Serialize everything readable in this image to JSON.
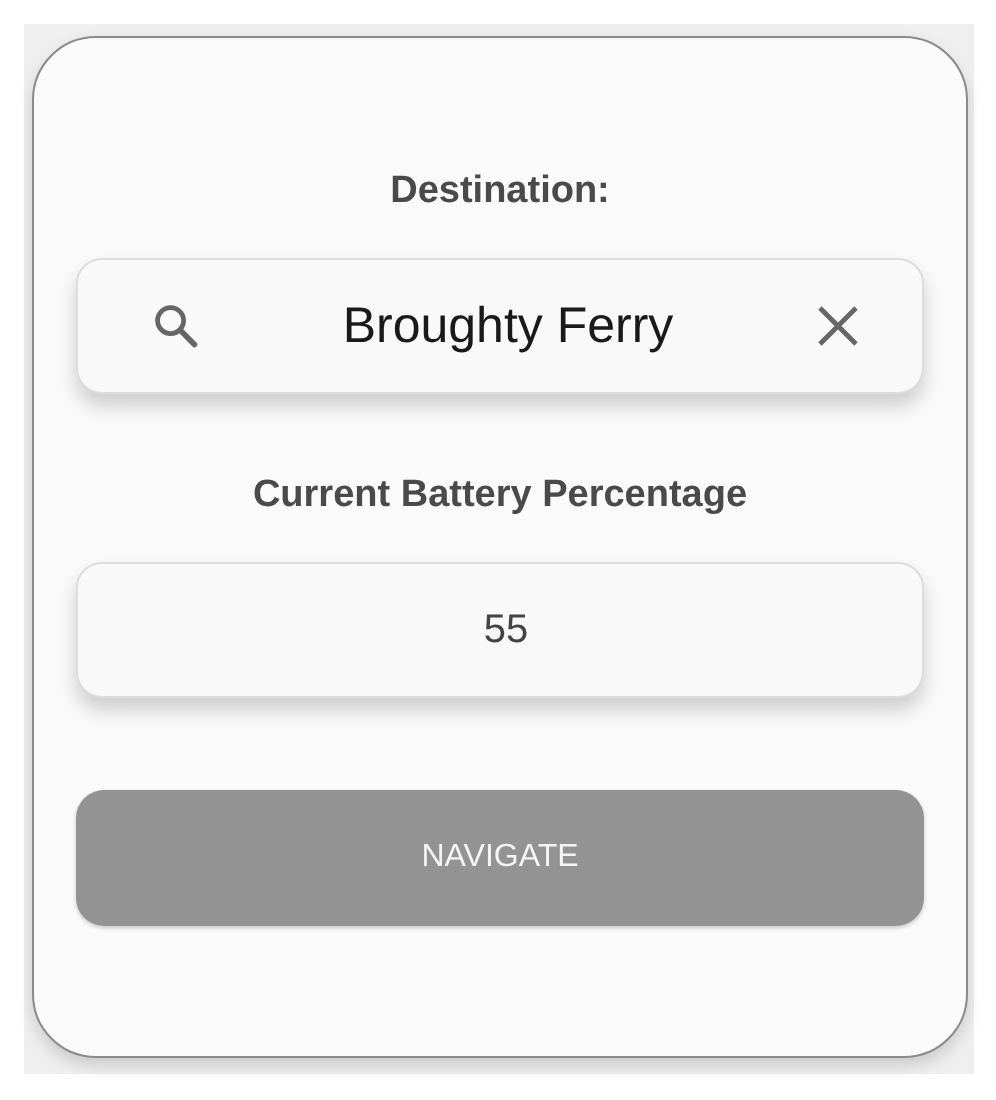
{
  "destination": {
    "label": "Destination:",
    "value": "Broughty Ferry"
  },
  "battery": {
    "label": "Current Battery Percentage",
    "value": "55"
  },
  "navigate_button": {
    "label": "NAVIGATE",
    "disabled": true
  }
}
